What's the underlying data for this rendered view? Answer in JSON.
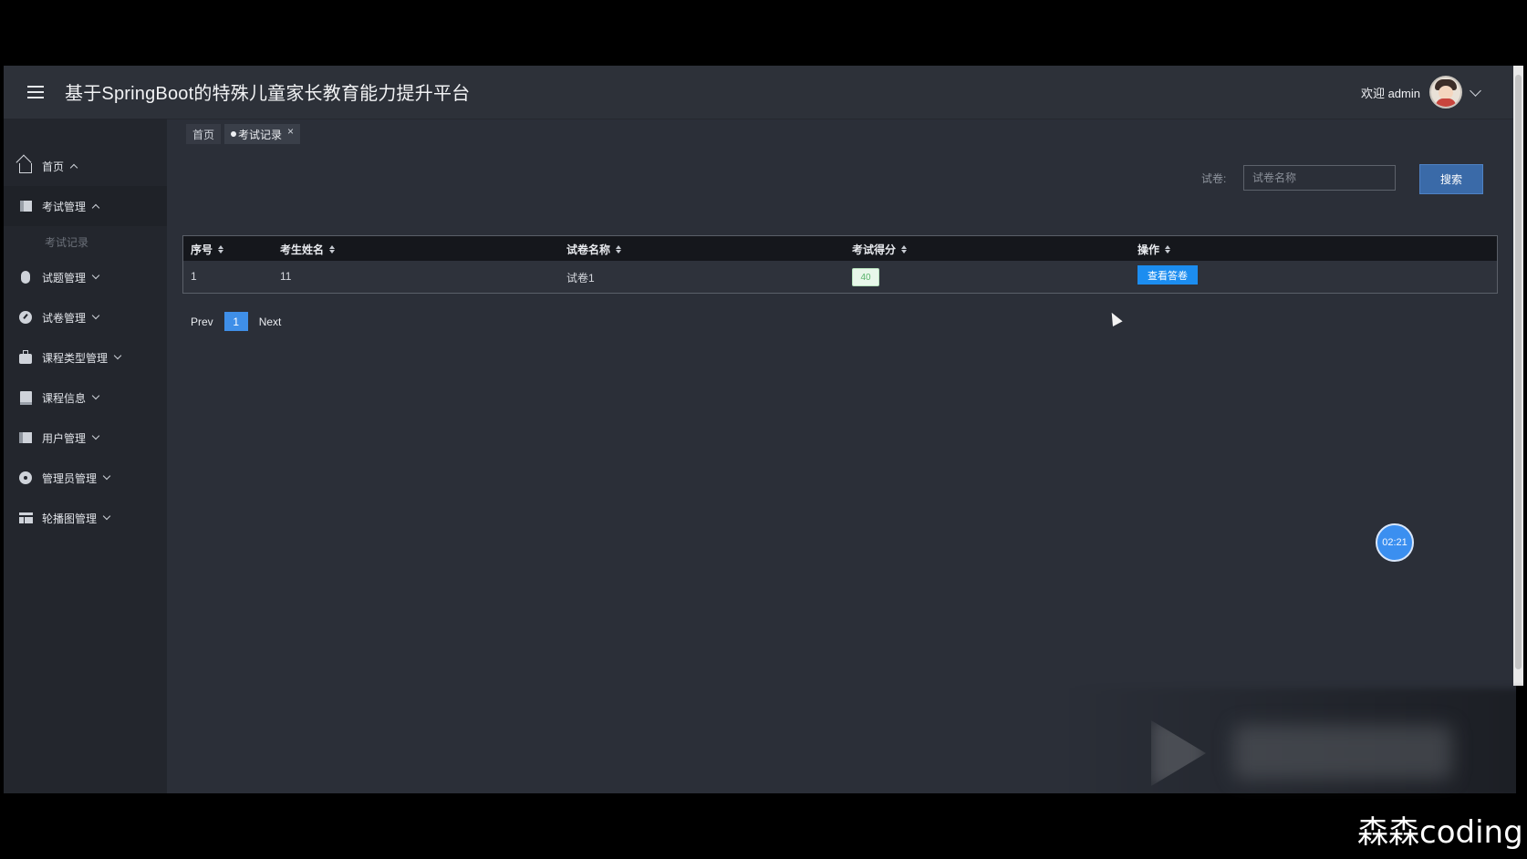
{
  "header": {
    "app_title": "基于SpringBoot的特殊儿童家长教育能力提升平台",
    "welcome": "欢迎 admin"
  },
  "sidebar": {
    "items": [
      {
        "label": "首页",
        "icon": "home-icon",
        "expanded": true
      },
      {
        "label": "考试管理",
        "icon": "book-icon",
        "expanded": true,
        "active": true
      },
      {
        "label": "试题管理",
        "icon": "mouse-icon"
      },
      {
        "label": "试卷管理",
        "icon": "gauge-icon"
      },
      {
        "label": "课程类型管理",
        "icon": "briefcase-icon"
      },
      {
        "label": "课程信息",
        "icon": "bookmark-icon"
      },
      {
        "label": "用户管理",
        "icon": "columns-icon"
      },
      {
        "label": "管理员管理",
        "icon": "disc-icon"
      },
      {
        "label": "轮播图管理",
        "icon": "table-icon"
      }
    ],
    "sub_item": "考试记录"
  },
  "tabs": [
    {
      "label": "首页"
    },
    {
      "label": "考试记录",
      "active": true
    }
  ],
  "search": {
    "label": "试卷:",
    "placeholder": "试卷名称",
    "button": "搜索"
  },
  "table": {
    "columns": [
      "序号",
      "考生姓名",
      "试卷名称",
      "考试得分",
      "操作"
    ],
    "rows": [
      {
        "index": "1",
        "name": "11",
        "paper": "试卷1",
        "score": "40",
        "action": "查看答卷"
      }
    ]
  },
  "pagination": {
    "prev": "Prev",
    "page": "1",
    "next": "Next"
  },
  "timer": "02:21",
  "overlay": {
    "brand": "森森coding"
  },
  "colors": {
    "accent": "#1c8df0",
    "sidebar_bg": "#23262d",
    "content_bg": "#2b2f38",
    "score_green": "#59b36b"
  }
}
